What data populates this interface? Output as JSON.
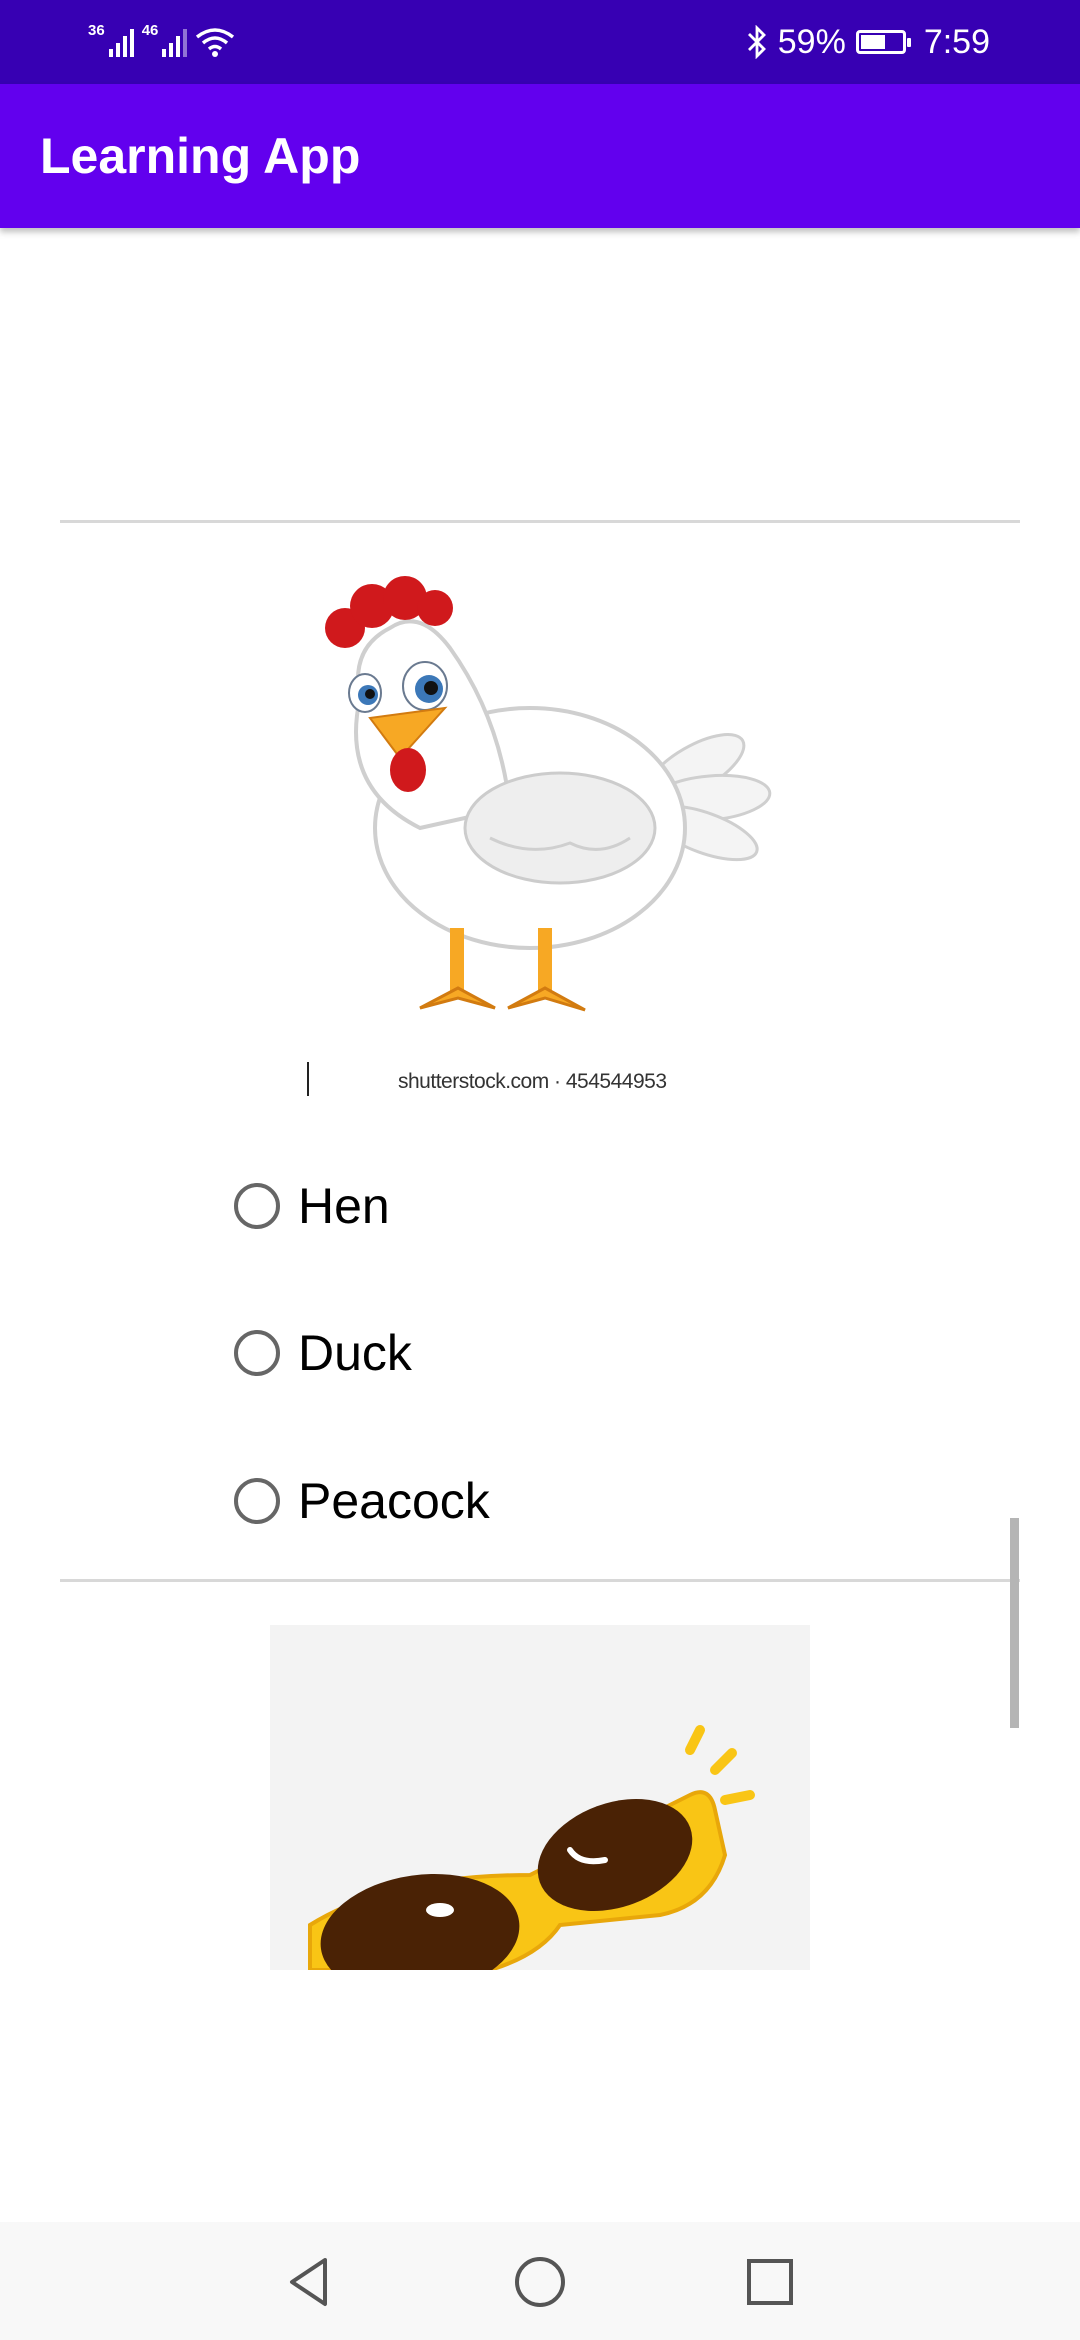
{
  "status_bar": {
    "signal1_label": "36",
    "signal2_label": "46",
    "bluetooth_icon": "bluetooth-icon",
    "battery_percent": "59%",
    "time": "7:59"
  },
  "app_bar": {
    "title": "Learning App"
  },
  "question": {
    "image_caption": "shutterstock.com · 454544953",
    "options": [
      {
        "label": "Hen",
        "selected": false
      },
      {
        "label": "Duck",
        "selected": false
      },
      {
        "label": "Peacock",
        "selected": false
      }
    ]
  },
  "navigation": {
    "back_icon": "back-triangle-icon",
    "home_icon": "home-circle-icon",
    "recents_icon": "recents-square-icon"
  },
  "colors": {
    "status_bar": "#3700B3",
    "app_bar": "#6200EE"
  }
}
